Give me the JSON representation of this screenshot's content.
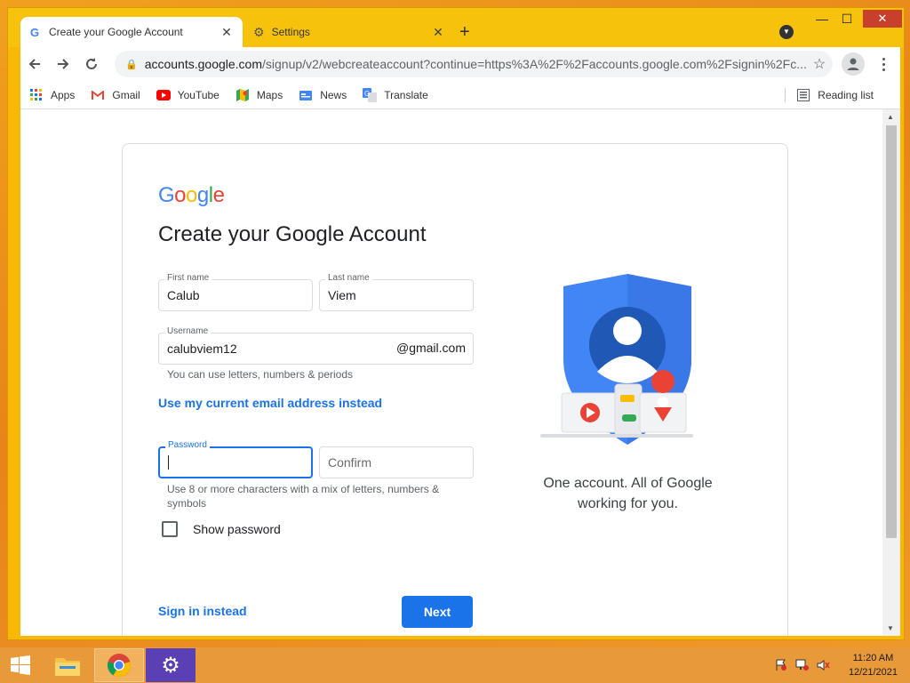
{
  "browser": {
    "tabs": [
      {
        "title": "Create your Google Account"
      },
      {
        "title": "Settings"
      }
    ],
    "url_domain": "accounts.google.com",
    "url_path": "/signup/v2/webcreateaccount?continue=https%3A%2F%2Faccounts.google.com%2Fsignin%2Fc...",
    "bookmarks": [
      {
        "label": "Apps",
        "icon": "apps-grid-icon"
      },
      {
        "label": "Gmail",
        "icon": "gmail-icon"
      },
      {
        "label": "YouTube",
        "icon": "youtube-icon"
      },
      {
        "label": "Maps",
        "icon": "maps-icon"
      },
      {
        "label": "News",
        "icon": "news-icon"
      },
      {
        "label": "Translate",
        "icon": "translate-icon"
      }
    ],
    "reading_list": "Reading list"
  },
  "form": {
    "logo": "Google",
    "heading": "Create your Google Account",
    "first_name_label": "First name",
    "first_name_value": "Calub",
    "last_name_label": "Last name",
    "last_name_value": "Viem",
    "username_label": "Username",
    "username_value": "calubviem12",
    "username_suffix": "@gmail.com",
    "username_hint": "You can use letters, numbers & periods",
    "use_email_link": "Use my current email address instead",
    "password_label": "Password",
    "password_value": "",
    "confirm_placeholder": "Confirm",
    "password_hint_line1": "Use 8 or more characters with a mix of letters, numbers &",
    "password_hint_line2": "symbols",
    "show_password_label": "Show password",
    "sign_in_link": "Sign in instead",
    "next_button": "Next",
    "tagline_line1": "One account. All of Google",
    "tagline_line2": "working for you."
  },
  "taskbar": {
    "time": "11:20 AM",
    "date": "12/21/2021"
  },
  "colors": {
    "accent": "#1a73e8",
    "desktop": "#e89a3a",
    "titlebar": "#f6c20c"
  }
}
